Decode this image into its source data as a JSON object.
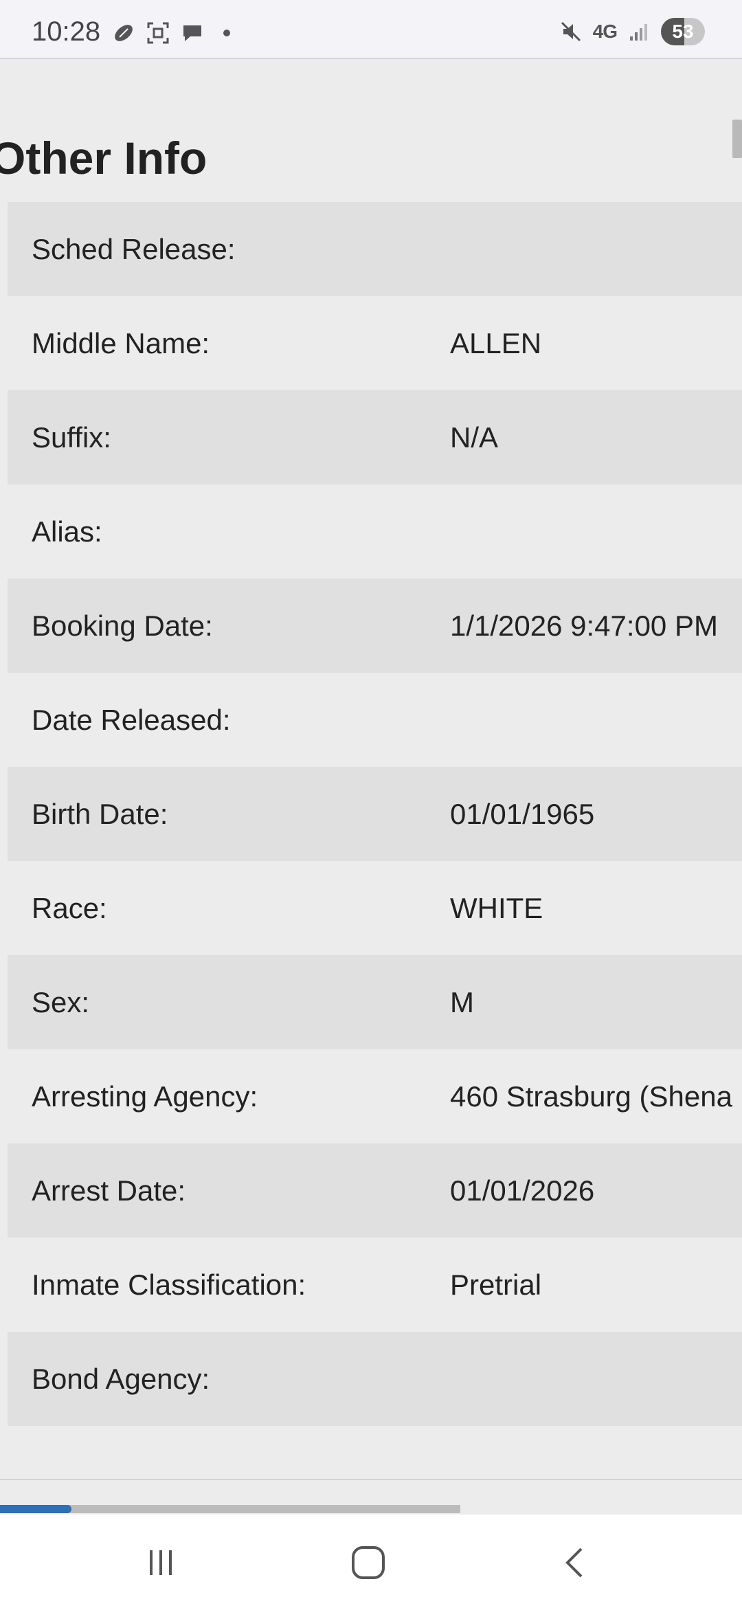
{
  "status_bar": {
    "time": "10:28",
    "left_icons": [
      "football-icon",
      "screenshot-icon",
      "chat-icon",
      "dot-icon"
    ],
    "network_label": "4G",
    "battery_level": "53"
  },
  "page": {
    "section_title": "Other Info",
    "rows": [
      {
        "label": "Sched Release:",
        "value": ""
      },
      {
        "label": "Middle Name:",
        "value": "ALLEN"
      },
      {
        "label": "Suffix:",
        "value": "N/A"
      },
      {
        "label": "Alias:",
        "value": ""
      },
      {
        "label": "Booking Date:",
        "value": "1/1/2026 9:47:00 PM"
      },
      {
        "label": "Date Released:",
        "value": ""
      },
      {
        "label": "Birth Date:",
        "value": "01/01/1965"
      },
      {
        "label": "Race:",
        "value": "WHITE"
      },
      {
        "label": "Sex:",
        "value": "M"
      },
      {
        "label": "Arresting Agency:",
        "value": "460 Strasburg (Shena"
      },
      {
        "label": "Arrest Date:",
        "value": "01/01/2026"
      },
      {
        "label": "Inmate Classification:",
        "value": "Pretrial"
      },
      {
        "label": "Bond Agency:",
        "value": ""
      }
    ]
  },
  "nav_bar": {
    "buttons": [
      "recents-icon",
      "home-icon",
      "back-icon"
    ]
  },
  "colors": {
    "background": "#ececec",
    "row_shaded": "#e0e0e0",
    "scroll_accent": "#2f6fb4"
  }
}
